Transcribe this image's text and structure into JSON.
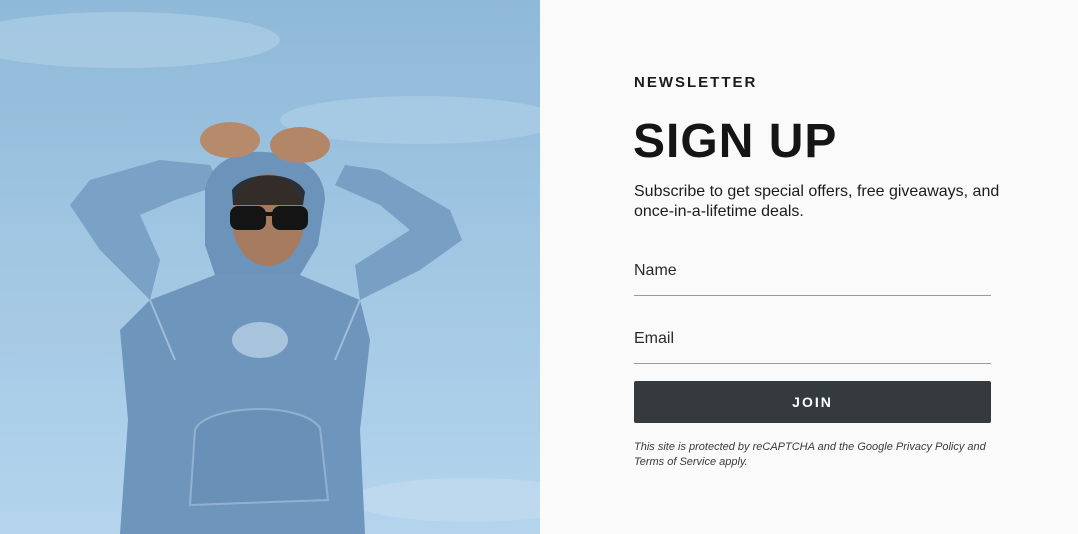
{
  "hero": {
    "image_description": "person in blue hoodie and sunglasses against blue sky"
  },
  "newsletter": {
    "eyebrow": "NEWSLETTER",
    "title": "SIGN UP",
    "subtitle": "Subscribe to get special offers, free giveaways, and once-in-a-lifetime deals.",
    "name_placeholder": "Name",
    "email_placeholder": "Email",
    "join_label": "JOIN",
    "legal_prefix": "This site is protected by reCAPTCHA and the Google ",
    "privacy_link": "Privacy Policy",
    "legal_and": " and ",
    "terms_link": "Terms of Service",
    "legal_suffix": " apply."
  },
  "colors": {
    "button_bg": "#353a3e",
    "sky": "#9cc3e0",
    "hoodie": "#6f97bd"
  }
}
